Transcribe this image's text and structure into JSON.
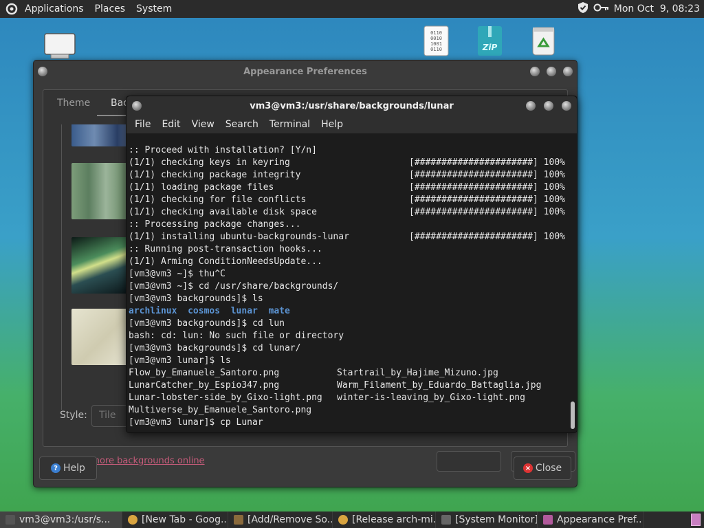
{
  "top_panel": {
    "menus": [
      "Applications",
      "Places",
      "System"
    ],
    "clock": "Mon Oct  9, 08:23"
  },
  "desktop_icons": [
    {
      "name": "computer",
      "icon": "monitor-icon"
    },
    {
      "name": "binary-file",
      "icon": "binary-file-icon",
      "text": "0101"
    },
    {
      "name": "zip-archive",
      "icon": "zip-icon",
      "text": "ZiP"
    },
    {
      "name": "trash",
      "icon": "trash-icon"
    }
  ],
  "appearance": {
    "title": "Appearance Preferences",
    "tabs": [
      "Theme",
      "Back"
    ],
    "style_label": "Style:",
    "style_value": "Tile",
    "get_more": "Get more backgrounds online",
    "help_label": "Help",
    "close_label": "Close"
  },
  "terminal": {
    "title": "vm3@vm3:/usr/share/backgrounds/lunar",
    "menu": [
      "File",
      "Edit",
      "View",
      "Search",
      "Terminal",
      "Help"
    ],
    "progress_bar": "[######################] 100%",
    "lines": [
      ":: Proceed with installation? [Y/n]",
      "(1/1) checking keys in keyring",
      "(1/1) checking package integrity",
      "(1/1) loading package files",
      "(1/1) checking for file conflicts",
      "(1/1) checking available disk space",
      ":: Processing package changes...",
      "(1/1) installing ubuntu-backgrounds-lunar",
      ":: Running post-transaction hooks...",
      "(1/1) Arming ConditionNeedsUpdate...",
      "[vm3@vm3 ~]$ thu^C",
      "[vm3@vm3 ~]$ cd /usr/share/backgrounds/",
      "[vm3@vm3 backgrounds]$ ls"
    ],
    "ls_dirs": [
      "archlinux",
      "cosmos",
      "lunar",
      "mate"
    ],
    "lines_after": [
      "[vm3@vm3 backgrounds]$ cd lun",
      "bash: cd: lun: No such file or directory",
      "[vm3@vm3 backgrounds]$ cd lunar/",
      "[vm3@vm3 lunar]$ ls"
    ],
    "ls_files": [
      [
        "Flow_by_Emanuele_Santoro.png",
        "Startrail_by_Hajime_Mizuno.jpg"
      ],
      [
        "LunarCatcher_by_Espio347.png",
        "Warm_Filament_by_Eduardo_Battaglia.jpg"
      ],
      [
        "Lunar-lobster-side_by_Gixo-light.png",
        "winter-is-leaving_by_Gixo-light.png"
      ],
      [
        "Multiverse_by_Emanuele_Santoro.png",
        ""
      ]
    ],
    "last_line": "[vm3@vm3 lunar]$ cp Lunar"
  },
  "taskbar": {
    "items": [
      {
        "label": "vm3@vm3:/usr/s...",
        "icon": "terminal-icon",
        "color": "#555555"
      },
      {
        "label": "[New Tab - Goog...",
        "icon": "chrome-icon",
        "color": "#d9a440"
      },
      {
        "label": "[Add/Remove So...",
        "icon": "package-icon",
        "color": "#8a6a3c"
      },
      {
        "label": "[Release arch-mi...",
        "icon": "chrome-icon",
        "color": "#d9a440"
      },
      {
        "label": "[System Monitor]",
        "icon": "system-monitor-icon",
        "color": "#666666"
      },
      {
        "label": "Appearance Pref...",
        "icon": "appearance-icon",
        "color": "#b25a9c"
      }
    ]
  }
}
